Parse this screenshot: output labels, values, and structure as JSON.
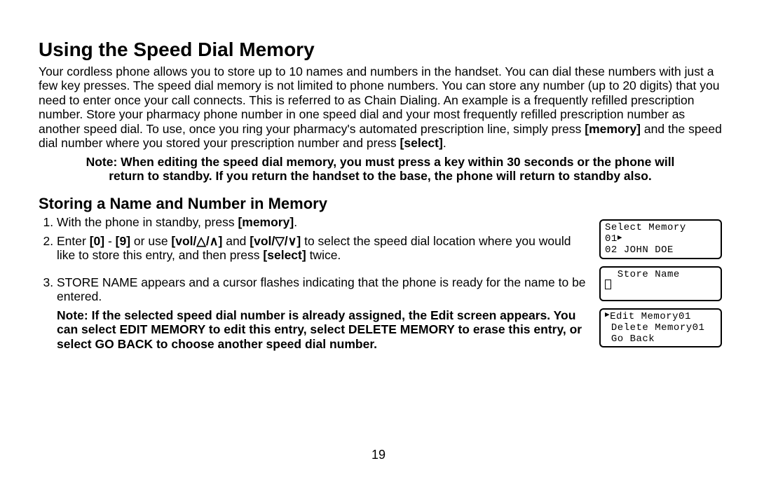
{
  "heading": "Using the Speed Dial Memory",
  "intro_parts": {
    "p1": "Your cordless phone allows you to store up to 10 names and numbers in the handset. You can dial these numbers with just a few key presses. The speed dial memory is not limited to phone numbers. You can store any number (up to 20 digits) that you need to enter once your call connects. This is referred to as Chain Dialing. An example is a frequently refilled prescription number. Store your pharmacy phone number in one speed dial and your most frequently refilled prescription number as another speed dial. To use, once you ring your pharmacy's automated prescription line, simply press ",
    "b1": "[memory]",
    "p2": " and the speed dial number where you stored your prescription number and press ",
    "b2": "[select]",
    "p3": "."
  },
  "note_center": "Note: When editing the speed dial memory, you must press a key within 30 seconds or the phone will return to standby. If you return the handset to the base, the phone will return to standby also.",
  "subheading": "Storing a Name and Number in Memory",
  "step1": {
    "t1": "With the phone in standby, press ",
    "b1": "[memory]",
    "t2": "."
  },
  "step2": {
    "t1": "Enter ",
    "b1": "[0]",
    "t2": " - ",
    "b2": "[9]",
    "t3": " or use ",
    "b3": "[vol/△/∧]",
    "t4": " and ",
    "b4": "[vol/▽/∨]",
    "t5": " to select the speed dial location where you would like to store this entry, and then press ",
    "b5": "[select]",
    "t6": " twice."
  },
  "step3": "STORE NAME appears and a cursor flashes indicating that the phone is ready for the name to be entered.",
  "step3_note": "Note: If the selected speed dial number is already assigned, the Edit screen appears. You can select EDIT MEMORY to edit this entry, select DELETE MEMORY to erase this entry, or select GO BACK to choose another speed dial number.",
  "lcd1": {
    "l1": "Select Memory",
    "l2a": "01",
    "l3": "02 JOHN DOE"
  },
  "lcd2": {
    "l1": "  Store Name"
  },
  "lcd3": {
    "l1a": "Edit Memory01",
    "l2": " Delete Memory01",
    "l3": " Go Back"
  },
  "page_number": "19"
}
